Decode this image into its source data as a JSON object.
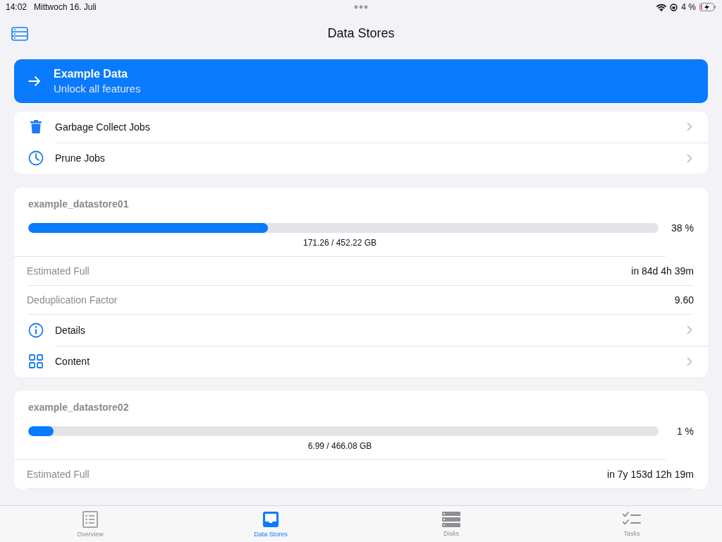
{
  "status_bar": {
    "time": "14:02",
    "date": "Mittwoch 16. Juli",
    "battery": "4 %"
  },
  "nav": {
    "title": "Data Stores"
  },
  "banner": {
    "title": "Example Data",
    "subtitle": "Unlock all features"
  },
  "actions": [
    {
      "label": "Garbage Collect Jobs",
      "kind": "trash"
    },
    {
      "label": "Prune Jobs",
      "kind": "clock"
    }
  ],
  "datastores": [
    {
      "name": "example_datastore01",
      "level": 0.38,
      "percent": "38 %",
      "usage": "171.26 / 452.22 GB",
      "rows": [
        {
          "kind": "value",
          "label": "Estimated Full",
          "value": "in 84d 4h 39m"
        },
        {
          "kind": "value",
          "label": "Deduplication Factor",
          "value": "9.60"
        },
        {
          "kind": "info",
          "label": "Details"
        },
        {
          "kind": "grid",
          "label": "Content"
        }
      ]
    },
    {
      "name": "example_datastore02",
      "level": 0.04,
      "percent": "1 %",
      "usage": "6.99 / 466.08 GB",
      "rows": [
        {
          "kind": "value",
          "label": "Estimated Full",
          "value": "in 7y 153d 12h 19m"
        }
      ]
    }
  ],
  "tabs": [
    {
      "label": "Overview",
      "kind": "list",
      "selected": false
    },
    {
      "label": "Data Stores",
      "kind": "tray",
      "selected": true
    },
    {
      "label": "Disks",
      "kind": "disks",
      "selected": false
    },
    {
      "label": "Tasks",
      "kind": "tasks",
      "selected": false
    }
  ]
}
